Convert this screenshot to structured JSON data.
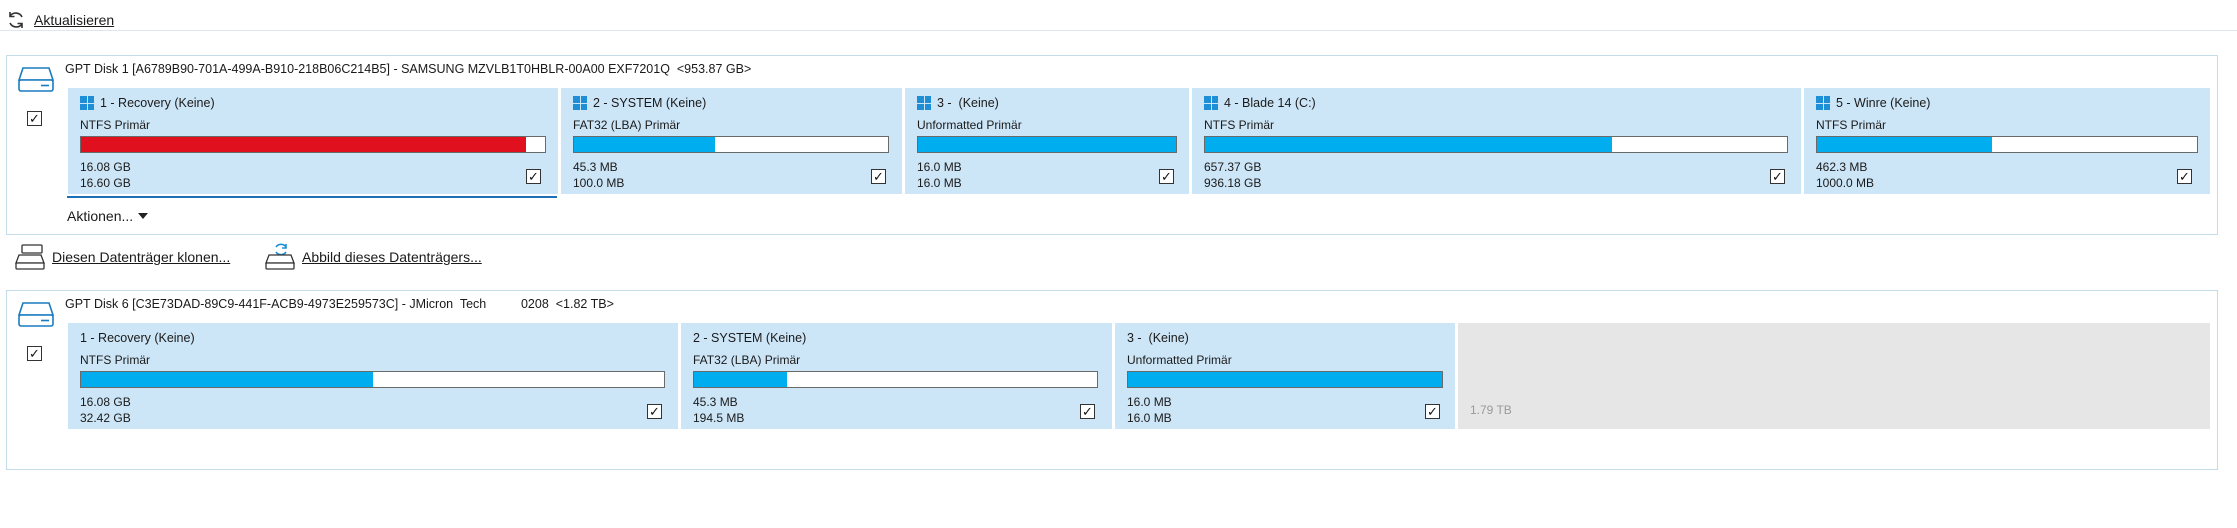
{
  "toolbar": {
    "refresh_label": "Aktualisieren"
  },
  "disk1": {
    "title": "GPT Disk 1 [A6789B90-701A-499A-B910-218B06C214B5] - SAMSUNG MZVLB1T0HBLR-00A00 EXF7201Q  <953.87 GB>",
    "checked": "✓",
    "partitions": [
      {
        "name": "1 - Recovery (Keine)",
        "fs": "NTFS Primär",
        "used": "16.08 GB",
        "total": "16.60 GB",
        "fill_fraction": 0.96,
        "fill_color": "#e0101e",
        "icon": "windows-icon",
        "check": "✓"
      },
      {
        "name": "2 - SYSTEM (Keine)",
        "fs": "FAT32 (LBA) Primär",
        "used": "45.3 MB",
        "total": "100.0 MB",
        "fill_fraction": 0.45,
        "fill_color": "#00aeef",
        "icon": "windows-icon",
        "check": "✓"
      },
      {
        "name": "3 -  (Keine)",
        "fs": "Unformatted Primär",
        "used": "16.0 MB",
        "total": "16.0 MB",
        "fill_fraction": 1.0,
        "fill_color": "#00aeef",
        "icon": "windows-icon",
        "check": "✓"
      },
      {
        "name": "4 - Blade 14 (C:)",
        "fs": "NTFS Primär",
        "used": "657.37 GB",
        "total": "936.18 GB",
        "fill_fraction": 0.7,
        "fill_color": "#00aeef",
        "icon": "windows-icon",
        "check": "✓"
      },
      {
        "name": "5 - Winre (Keine)",
        "fs": "NTFS Primär",
        "used": "462.3 MB",
        "total": "1000.0 MB",
        "fill_fraction": 0.46,
        "fill_color": "#00aeef",
        "icon": "windows-icon",
        "check": "✓"
      }
    ],
    "actions_label": "Aktionen..."
  },
  "operations": {
    "clone_label": "Diesen Datenträger klonen...",
    "image_label": "Abbild dieses Datenträgers..."
  },
  "disk2": {
    "title": "GPT Disk 6 [C3E73DAD-89C9-441F-ACB9-4973E259573C] - JMicron  Tech          0208  <1.82 TB>",
    "checked": "✓",
    "partitions": [
      {
        "name": "1 - Recovery (Keine)",
        "fs": "NTFS Primär",
        "used": "16.08 GB",
        "total": "32.42 GB",
        "fill_fraction": 0.5,
        "fill_color": "#00aeef",
        "check": "✓"
      },
      {
        "name": "2 - SYSTEM (Keine)",
        "fs": "FAT32 (LBA) Primär",
        "used": "45.3 MB",
        "total": "194.5 MB",
        "fill_fraction": 0.23,
        "fill_color": "#00aeef",
        "check": "✓"
      },
      {
        "name": "3 -  (Keine)",
        "fs": "Unformatted Primär",
        "used": "16.0 MB",
        "total": "16.0 MB",
        "fill_fraction": 1.0,
        "fill_color": "#00aeef",
        "check": "✓"
      }
    ],
    "unallocated_size": "1.79 TB"
  }
}
